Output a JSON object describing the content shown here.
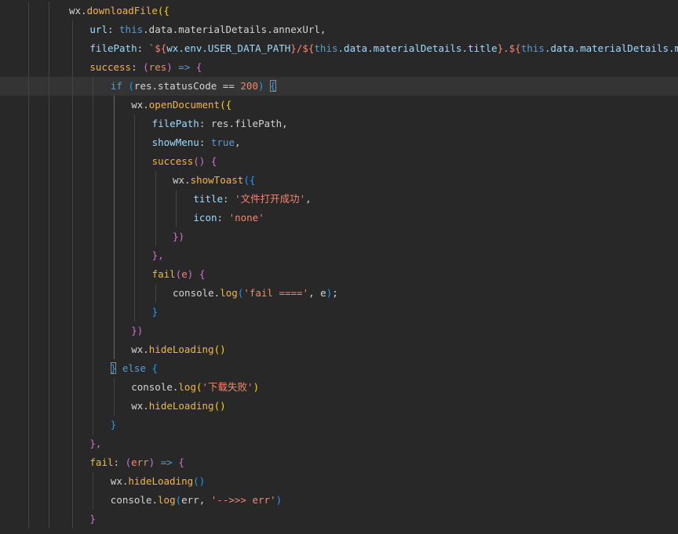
{
  "colors": {
    "background": "#282828",
    "current_line": "#343434",
    "default_text": "#d4d4d4",
    "property": "#9cdcfe",
    "function": "#f0b840",
    "keyword": "#569cd6",
    "string": "#f48771",
    "number": "#f48771",
    "bracket_gold": "#ffd700",
    "bracket_purple": "#da70d6",
    "bracket_blue": "#179fff",
    "indent_guide": "#444444"
  },
  "lines": [
    {
      "indent": 0,
      "tokens": [
        {
          "t": "wx.",
          "c": "default"
        },
        {
          "t": "downloadFile",
          "c": "function"
        },
        {
          "t": "({",
          "c": "bracket_gold"
        }
      ]
    },
    {
      "indent": 1,
      "tokens": [
        {
          "t": "url",
          "c": "property"
        },
        {
          "t": ": ",
          "c": "default"
        },
        {
          "t": "this",
          "c": "keyword"
        },
        {
          "t": ".data.materialDetails.annexUrl,",
          "c": "default"
        }
      ]
    },
    {
      "indent": 1,
      "tokens": [
        {
          "t": "filePath",
          "c": "property"
        },
        {
          "t": ": ",
          "c": "default"
        },
        {
          "t": "`${",
          "c": "string"
        },
        {
          "t": "wx.env.USER_DATA_PATH",
          "c": "property"
        },
        {
          "t": "}/${",
          "c": "string"
        },
        {
          "t": "this",
          "c": "keyword"
        },
        {
          "t": ".data.materialDetails.title",
          "c": "property"
        },
        {
          "t": "}.${",
          "c": "string"
        },
        {
          "t": "this",
          "c": "keyword"
        },
        {
          "t": ".data.materialDetails.materialType",
          "c": "property"
        },
        {
          "t": "}`,",
          "c": "string"
        }
      ]
    },
    {
      "indent": 1,
      "tokens": [
        {
          "t": "success",
          "c": "function"
        },
        {
          "t": ": ",
          "c": "default"
        },
        {
          "t": "(",
          "c": "bracket_purple"
        },
        {
          "t": "res",
          "c": "string"
        },
        {
          "t": ")",
          "c": "bracket_purple"
        },
        {
          "t": " => ",
          "c": "keyword"
        },
        {
          "t": "{",
          "c": "bracket_purple"
        }
      ]
    },
    {
      "indent": 2,
      "tokens": [
        {
          "t": "if",
          "c": "keyword"
        },
        {
          "t": " ",
          "c": "default"
        },
        {
          "t": "(",
          "c": "bracket_blue"
        },
        {
          "t": "res.statusCode == ",
          "c": "default"
        },
        {
          "t": "200",
          "c": "number"
        },
        {
          "t": ")",
          "c": "bracket_blue"
        },
        {
          "t": " ",
          "c": "default"
        },
        {
          "t": "{",
          "c": "bracket_blue",
          "box": true
        }
      ]
    },
    {
      "indent": 3,
      "tokens": [
        {
          "t": "wx.",
          "c": "default"
        },
        {
          "t": "openDocument",
          "c": "function"
        },
        {
          "t": "({",
          "c": "bracket_gold"
        }
      ]
    },
    {
      "indent": 4,
      "tokens": [
        {
          "t": "filePath",
          "c": "property"
        },
        {
          "t": ": res.filePath,",
          "c": "default"
        }
      ]
    },
    {
      "indent": 4,
      "tokens": [
        {
          "t": "showMenu",
          "c": "property"
        },
        {
          "t": ": ",
          "c": "default"
        },
        {
          "t": "true",
          "c": "keyword"
        },
        {
          "t": ",",
          "c": "default"
        }
      ]
    },
    {
      "indent": 4,
      "tokens": [
        {
          "t": "success",
          "c": "function"
        },
        {
          "t": "() {",
          "c": "bracket_purple"
        }
      ]
    },
    {
      "indent": 5,
      "tokens": [
        {
          "t": "wx.",
          "c": "default"
        },
        {
          "t": "showToast",
          "c": "function"
        },
        {
          "t": "({",
          "c": "bracket_blue"
        }
      ]
    },
    {
      "indent": 6,
      "tokens": [
        {
          "t": "title",
          "c": "property"
        },
        {
          "t": ": ",
          "c": "default"
        },
        {
          "t": "'文件打开成功'",
          "c": "string"
        },
        {
          "t": ",",
          "c": "default"
        }
      ]
    },
    {
      "indent": 6,
      "tokens": [
        {
          "t": "icon",
          "c": "property"
        },
        {
          "t": ": ",
          "c": "default"
        },
        {
          "t": "'none'",
          "c": "string"
        }
      ]
    },
    {
      "indent": 5,
      "tokens": [
        {
          "t": "})",
          "c": "bracket_purple"
        }
      ]
    },
    {
      "indent": 4,
      "tokens": [
        {
          "t": "},",
          "c": "bracket_purple"
        }
      ]
    },
    {
      "indent": 4,
      "tokens": [
        {
          "t": "fail",
          "c": "function"
        },
        {
          "t": "(",
          "c": "bracket_purple"
        },
        {
          "t": "e",
          "c": "string"
        },
        {
          "t": ") {",
          "c": "bracket_purple"
        }
      ]
    },
    {
      "indent": 5,
      "tokens": [
        {
          "t": "console.",
          "c": "default"
        },
        {
          "t": "log",
          "c": "function"
        },
        {
          "t": "(",
          "c": "bracket_blue"
        },
        {
          "t": "'fail ===='",
          "c": "string"
        },
        {
          "t": ", e",
          "c": "default"
        },
        {
          "t": ")",
          "c": "bracket_blue"
        },
        {
          "t": ";",
          "c": "default"
        }
      ]
    },
    {
      "indent": 4,
      "tokens": [
        {
          "t": "}",
          "c": "bracket_blue"
        }
      ]
    },
    {
      "indent": 3,
      "tokens": [
        {
          "t": "})",
          "c": "bracket_purple"
        }
      ]
    },
    {
      "indent": 3,
      "tokens": [
        {
          "t": "wx.",
          "c": "default"
        },
        {
          "t": "hideLoading",
          "c": "function"
        },
        {
          "t": "()",
          "c": "bracket_gold"
        }
      ]
    },
    {
      "indent": 2,
      "tokens": [
        {
          "t": "}",
          "c": "bracket_blue",
          "box": true
        },
        {
          "t": " else ",
          "c": "keyword"
        },
        {
          "t": "{",
          "c": "bracket_blue"
        }
      ]
    },
    {
      "indent": 3,
      "tokens": [
        {
          "t": "console.",
          "c": "default"
        },
        {
          "t": "log",
          "c": "function"
        },
        {
          "t": "(",
          "c": "bracket_gold"
        },
        {
          "t": "'下载失败'",
          "c": "string"
        },
        {
          "t": ")",
          "c": "bracket_gold"
        }
      ]
    },
    {
      "indent": 3,
      "tokens": [
        {
          "t": "wx.",
          "c": "default"
        },
        {
          "t": "hideLoading",
          "c": "function"
        },
        {
          "t": "()",
          "c": "bracket_gold"
        }
      ]
    },
    {
      "indent": 2,
      "tokens": [
        {
          "t": "}",
          "c": "bracket_blue"
        }
      ]
    },
    {
      "indent": 1,
      "tokens": [
        {
          "t": "},",
          "c": "bracket_purple"
        }
      ]
    },
    {
      "indent": 1,
      "tokens": [
        {
          "t": "fail",
          "c": "function"
        },
        {
          "t": ": ",
          "c": "default"
        },
        {
          "t": "(",
          "c": "bracket_purple"
        },
        {
          "t": "err",
          "c": "string"
        },
        {
          "t": ")",
          "c": "bracket_purple"
        },
        {
          "t": " => ",
          "c": "keyword"
        },
        {
          "t": "{",
          "c": "bracket_purple"
        }
      ]
    },
    {
      "indent": 2,
      "tokens": [
        {
          "t": "wx.",
          "c": "default"
        },
        {
          "t": "hideLoading",
          "c": "function"
        },
        {
          "t": "()",
          "c": "bracket_blue"
        }
      ]
    },
    {
      "indent": 2,
      "tokens": [
        {
          "t": "console.",
          "c": "default"
        },
        {
          "t": "log",
          "c": "function"
        },
        {
          "t": "(",
          "c": "bracket_blue"
        },
        {
          "t": "err, ",
          "c": "default"
        },
        {
          "t": "'-->>> err'",
          "c": "string"
        },
        {
          "t": ")",
          "c": "bracket_blue"
        }
      ]
    },
    {
      "indent": 1,
      "tokens": [
        {
          "t": "}",
          "c": "bracket_purple"
        }
      ]
    }
  ]
}
